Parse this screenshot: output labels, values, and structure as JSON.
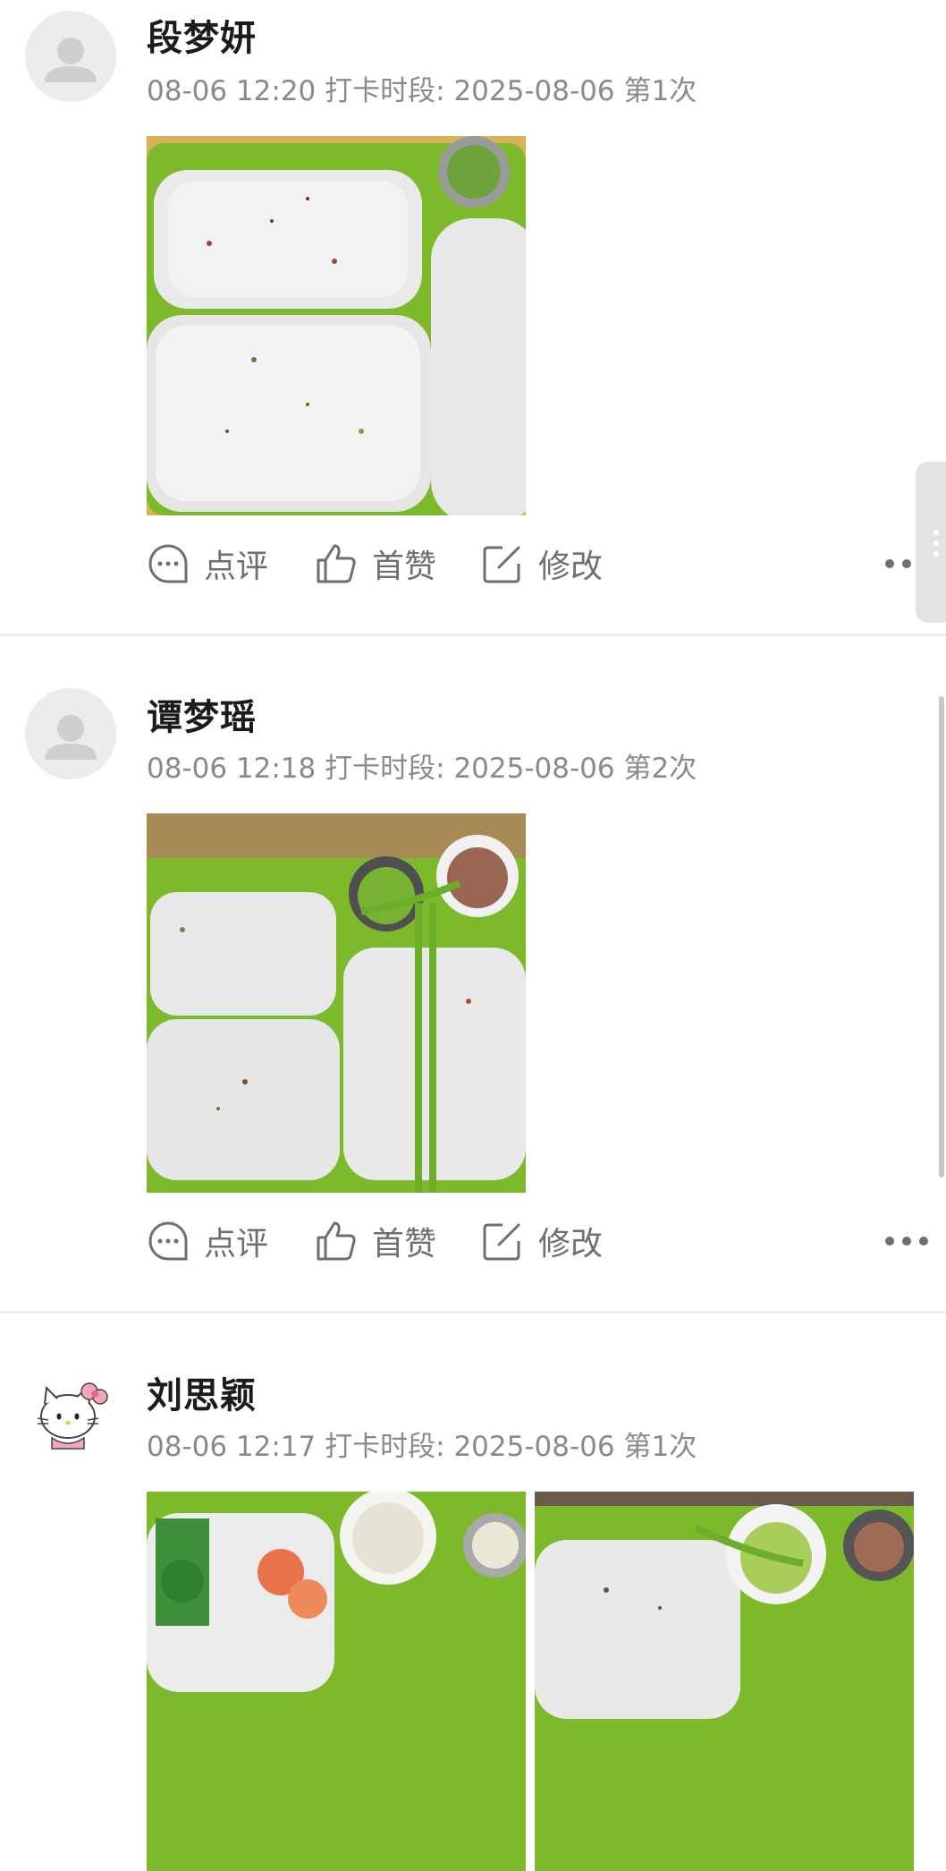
{
  "posts": [
    {
      "name": "段梦妍",
      "time": "08-06 12:20",
      "period_label": "打卡时段:",
      "period_date": "2025-08-06",
      "count": "第1次",
      "avatar": "person-placeholder-icon",
      "photos": 1
    },
    {
      "name": "谭梦瑶",
      "time": "08-06 12:18",
      "period_label": "打卡时段:",
      "period_date": "2025-08-06",
      "count": "第2次",
      "avatar": "person-placeholder-icon",
      "photos": 1
    },
    {
      "name": "刘思颖",
      "time": "08-06 12:17",
      "period_label": "打卡时段:",
      "period_date": "2025-08-06",
      "count": "第1次",
      "avatar": "hello-kitty-icon",
      "photos": 2
    }
  ],
  "actions": {
    "comment": "点评",
    "like": "首赞",
    "edit": "修改"
  },
  "colors": {
    "tray_green": "#7dbb2c",
    "meta_gray": "#8a8a8a",
    "action_gray": "#6f6f6f"
  }
}
